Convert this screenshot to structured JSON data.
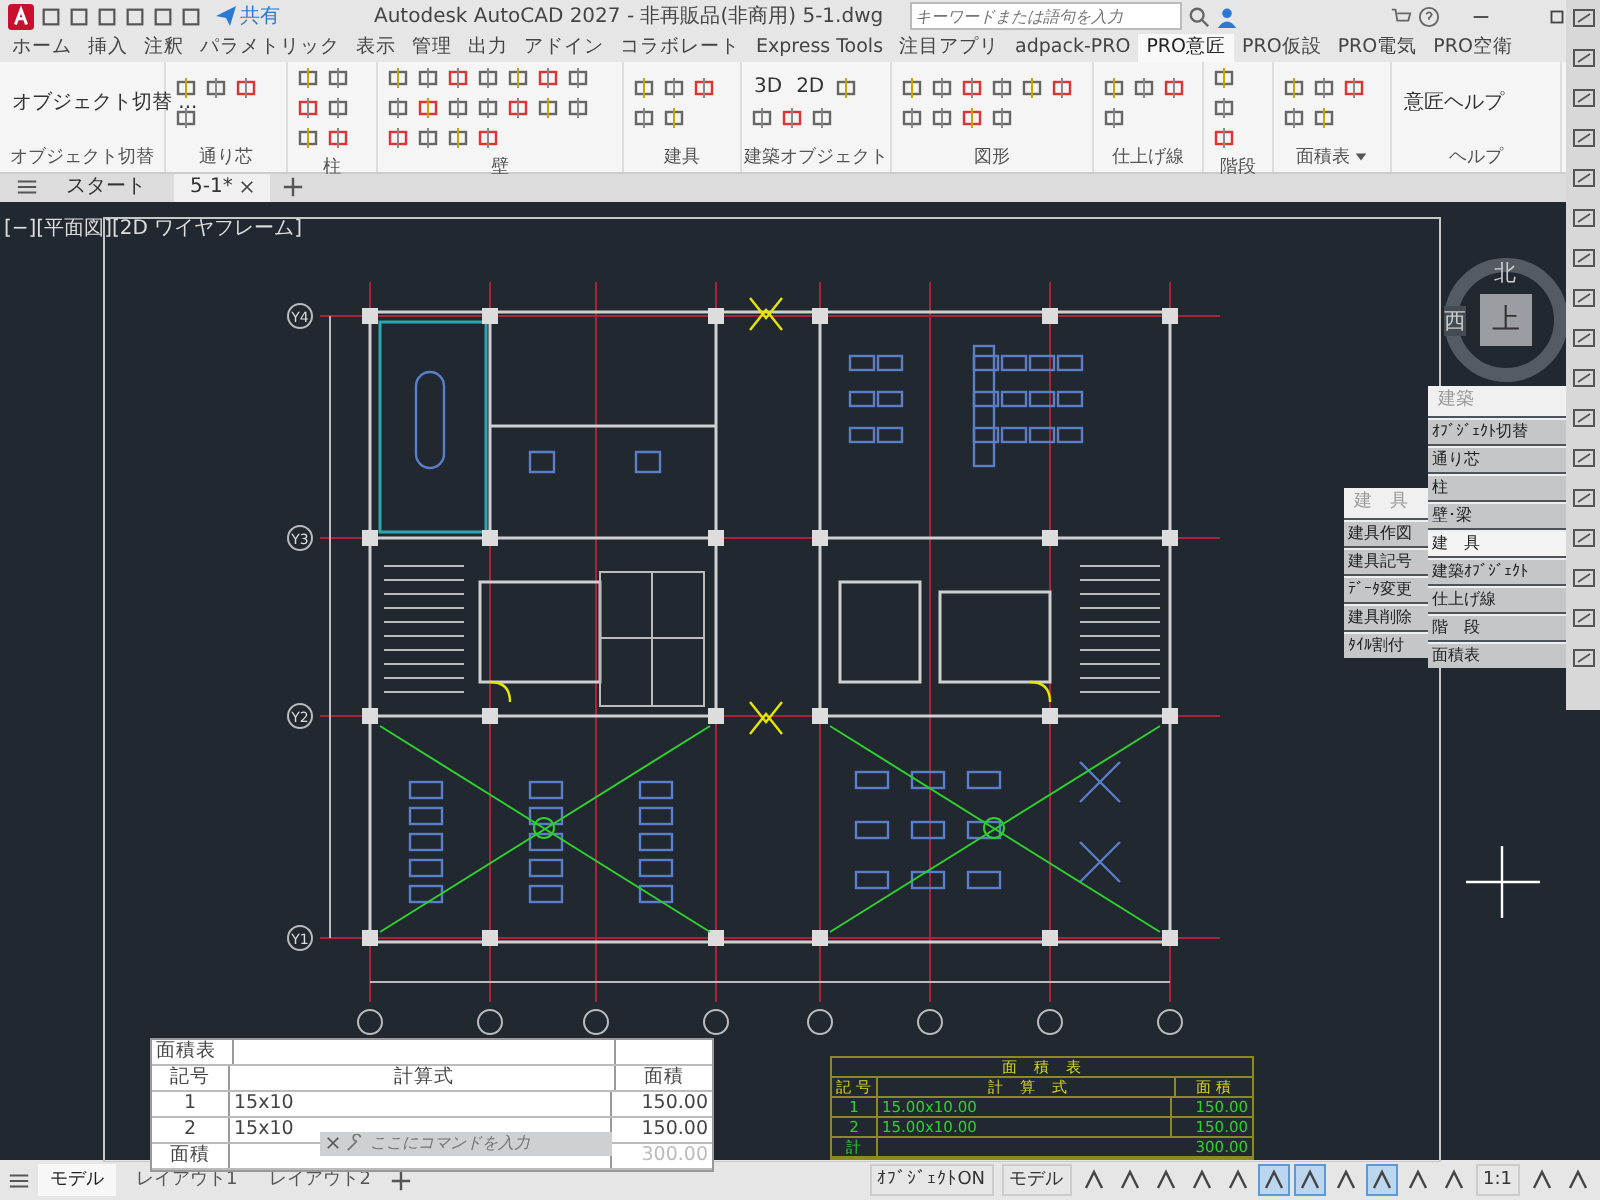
{
  "title_bar": {
    "share": "共有",
    "title": "Autodesk AutoCAD 2027 - 非再販品(非商用)   5-1.dwg",
    "search": {
      "placeholder": "キーワードまたは語句を入力"
    }
  },
  "menu_tabs": [
    {
      "label": "ホーム",
      "selected": false
    },
    {
      "label": "挿入",
      "selected": false
    },
    {
      "label": "注釈",
      "selected": false
    },
    {
      "label": "パラメトリック",
      "selected": false
    },
    {
      "label": "表示",
      "selected": false
    },
    {
      "label": "管理",
      "selected": false
    },
    {
      "label": "出力",
      "selected": false
    },
    {
      "label": "アドイン",
      "selected": false
    },
    {
      "label": "コラボレート",
      "selected": false
    },
    {
      "label": "Express Tools",
      "selected": false
    },
    {
      "label": "注目アプリ",
      "selected": false
    },
    {
      "label": "adpack-PRO",
      "selected": false
    },
    {
      "label": "PRO意匠",
      "selected": true
    },
    {
      "label": "PRO仮設",
      "selected": false
    },
    {
      "label": "PRO電気",
      "selected": false
    },
    {
      "label": "PRO空衛",
      "selected": false
    }
  ],
  "ribbon_groups": [
    {
      "label": "オブジェクト切替",
      "buttons": [
        "オブジェクト切替 ..."
      ]
    },
    {
      "label": "通り芯"
    },
    {
      "label": "柱"
    },
    {
      "label": "壁"
    },
    {
      "label": "建具"
    },
    {
      "label": "建築オブジェクト",
      "buttons": [
        "3D",
        "2D"
      ]
    },
    {
      "label": "図形"
    },
    {
      "label": "仕上げ線"
    },
    {
      "label": "階段"
    },
    {
      "label": "面積表",
      "menu": true
    },
    {
      "label": "ヘルプ",
      "buttons": [
        "意匠ヘルプ"
      ]
    }
  ],
  "file_tabs": [
    {
      "label": "スタート",
      "selected": false,
      "closable": false
    },
    {
      "label": "5-1*",
      "selected": true,
      "closable": true
    }
  ],
  "viewport_label": "[−][平面図][2D ワイヤフレーム]",
  "plan": {
    "row_axes": [
      "Y4",
      "Y3",
      "Y2",
      "Y1"
    ]
  },
  "view_cube": {
    "north": "北",
    "west": "西",
    "face": "上"
  },
  "palette_main": {
    "title": "建築",
    "items": [
      {
        "label": "ｵﾌﾞｼﾞｪｸﾄ切替",
        "selected": false
      },
      {
        "label": "通り芯",
        "selected": false
      },
      {
        "label": "柱",
        "selected": false
      },
      {
        "label": "壁･梁",
        "selected": false
      },
      {
        "label": "建　具",
        "selected": true
      },
      {
        "label": "建築ｵﾌﾞｼﾞｪｸﾄ",
        "selected": false
      },
      {
        "label": "仕上げ線",
        "selected": false
      },
      {
        "label": "階　段",
        "selected": false
      },
      {
        "label": "面積表",
        "selected": false
      }
    ]
  },
  "palette_sub": {
    "title": "建　具",
    "items": [
      "建具作図",
      "建具記号",
      "ﾃﾞｰﾀ変更",
      "建具削除",
      "ﾀｲﾙ割付"
    ]
  },
  "area_table": {
    "title": "面積表",
    "columns": [
      "記号",
      "計算式",
      "面積"
    ],
    "rows": [
      [
        "1",
        "15x10",
        "150.00"
      ],
      [
        "2",
        "15x10",
        "150.00"
      ]
    ],
    "total": [
      "面積",
      "300.00"
    ]
  },
  "green_table": {
    "title": "面　積　表",
    "columns": [
      "記 号",
      "計　算　式",
      "面 積"
    ],
    "rows": [
      [
        "1",
        "15.00x10.00",
        "150.00"
      ],
      [
        "2",
        "15.00x10.00",
        "150.00"
      ]
    ],
    "total": [
      "計",
      "300.00"
    ]
  },
  "command_line": {
    "placeholder": "ここにコマンドを入力"
  },
  "layout_tabs": [
    {
      "label": "モデル",
      "selected": true
    },
    {
      "label": "レイアウト1",
      "selected": false
    },
    {
      "label": "レイアウト2",
      "selected": false
    }
  ],
  "status_bar": [
    {
      "kind": "text",
      "label": "ｵﾌﾞｼﾞｪｸﾄON"
    },
    {
      "kind": "text",
      "label": "モデル"
    },
    {
      "kind": "toggle",
      "on": false
    },
    {
      "kind": "toggle",
      "on": false
    },
    {
      "kind": "toggle",
      "on": false
    },
    {
      "kind": "toggle",
      "on": false
    },
    {
      "kind": "toggle",
      "on": false
    },
    {
      "kind": "toggle",
      "on": true
    },
    {
      "kind": "toggle",
      "on": true
    },
    {
      "kind": "toggle",
      "on": false
    },
    {
      "kind": "toggle",
      "on": true
    },
    {
      "kind": "toggle",
      "on": false
    },
    {
      "kind": "toggle",
      "on": false
    },
    {
      "kind": "text",
      "label": "1:1"
    },
    {
      "kind": "toggle",
      "on": false
    },
    {
      "kind": "toggle",
      "on": false
    }
  ]
}
